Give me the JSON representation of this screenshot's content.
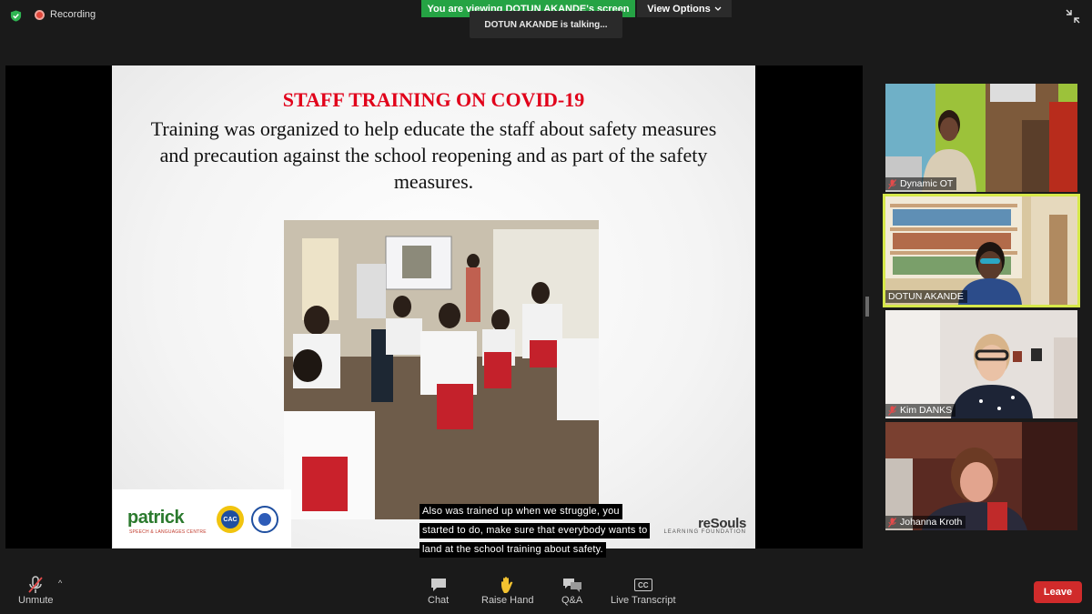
{
  "top_bar": {
    "recording_label": "Recording",
    "viewing_banner": "You are viewing DOTUN AKANDE's screen",
    "view_options_label": "View Options",
    "talking_indicator": "DOTUN AKANDE is talking..."
  },
  "slide": {
    "title": "STAFF TRAINING ON COVID-19",
    "body": "Training was organized to help educate the staff about safety measures and precaution against the school reopening and as part of the safety measures.",
    "logo_text": "patrick",
    "logo_subtext": "SPEECH & LANGUAGES CENTRE",
    "badge_text": "CAC",
    "partner_name": "reSouls",
    "partner_subtext": "LEARNING FOUNDATION"
  },
  "caption": {
    "lines": [
      "Also was trained up when we struggle, you",
      "started to do, make sure that everybody wants to",
      "land at the school training about safety."
    ]
  },
  "participants": [
    {
      "name": "Dynamic OT",
      "active": false
    },
    {
      "name": "DOTUN AKANDE",
      "active": true
    },
    {
      "name": "Kim DANKS",
      "active": false
    },
    {
      "name": "Johanna Kroth",
      "active": false
    }
  ],
  "bottom_bar": {
    "unmute_label": "Unmute",
    "chat_label": "Chat",
    "raise_hand_label": "Raise Hand",
    "qa_label": "Q&A",
    "transcript_label": "Live Transcript",
    "transcript_icon_text": "CC",
    "leave_label": "Leave"
  },
  "colors": {
    "viewing_banner": "#25a344",
    "leave_button": "#d02b2b",
    "active_speaker_border": "#d6e84a",
    "slide_title": "#e1001a"
  }
}
